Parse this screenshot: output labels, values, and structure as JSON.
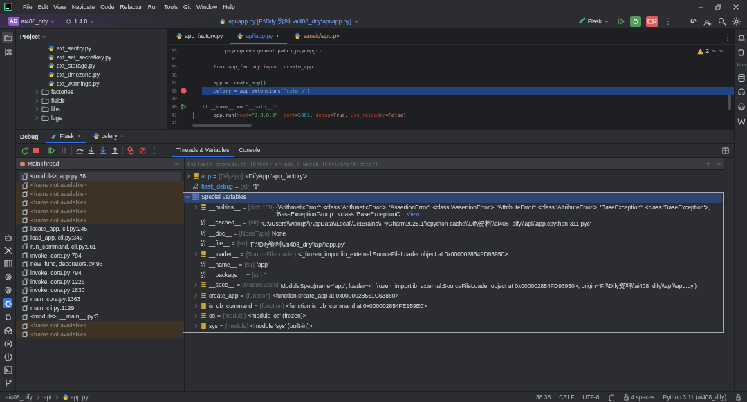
{
  "menu": [
    "File",
    "Edit",
    "View",
    "Navigate",
    "Code",
    "Refactor",
    "Run",
    "Tools",
    "Git",
    "Window",
    "Help"
  ],
  "toolbar": {
    "project_badge": "AD",
    "project": "ai408_dify",
    "version": "1.4.0",
    "file_title": "api\\app.py [F:\\Dify资料\\ai408_dify\\api\\app.py]",
    "run_config": "Flask",
    "stop_count": "2"
  },
  "project_panel": {
    "title": "Project",
    "items": [
      {
        "kind": "file",
        "name": "ext_sentry.py"
      },
      {
        "kind": "file",
        "name": "ext_set_secretkey.py"
      },
      {
        "kind": "file",
        "name": "ext_storage.py"
      },
      {
        "kind": "file",
        "name": "ext_timezone.py"
      },
      {
        "kind": "file",
        "name": "ext_warnings.py"
      },
      {
        "kind": "folder",
        "name": "factories",
        "expanded": false
      },
      {
        "kind": "folder",
        "name": "fields",
        "expanded": false
      },
      {
        "kind": "folder",
        "name": "libs",
        "expanded": false
      },
      {
        "kind": "folder",
        "name": "logs",
        "expanded": false
      }
    ]
  },
  "editor": {
    "tabs": [
      {
        "kind": "project",
        "label": "app_factory.py",
        "selected": false,
        "closable": false
      },
      {
        "kind": "project",
        "label": "api\\app.py",
        "selected": true,
        "closable": true
      },
      {
        "kind": "library",
        "label": "sansio\\app.py",
        "selected": false,
        "closable": false
      }
    ],
    "warnings": "2",
    "lines": [
      {
        "number": "33",
        "breakpoint": false,
        "run": false,
        "current": false,
        "modified": false,
        "tokens": [
          {
            "kind": "plain",
            "text": "        psycogreen.gevent.patch_psycopg()"
          }
        ]
      },
      {
        "number": "34",
        "breakpoint": false,
        "run": false,
        "current": false,
        "modified": false
      },
      {
        "number": "35",
        "breakpoint": false,
        "run": false,
        "current": false,
        "modified": false,
        "tokens": [
          {
            "kind": "keyword",
            "text": "    from"
          },
          {
            "kind": "plain",
            "text": " app_factory "
          },
          {
            "kind": "keyword",
            "text": "import"
          },
          {
            "kind": "plain",
            "text": " create_app"
          }
        ]
      },
      {
        "number": "36",
        "breakpoint": false,
        "run": false,
        "current": false,
        "modified": false
      },
      {
        "number": "37",
        "breakpoint": false,
        "run": false,
        "current": false,
        "modified": false,
        "tokens": [
          {
            "kind": "plain",
            "text": "    app = create_app()"
          }
        ]
      },
      {
        "number": "38",
        "breakpoint": true,
        "run": false,
        "current": true,
        "modified": false,
        "tokens": [
          {
            "kind": "plain",
            "text": "    celery = app.extensions["
          },
          {
            "kind": "string",
            "text": "\"celery\""
          },
          {
            "kind": "plain",
            "text": "]"
          }
        ]
      },
      {
        "number": "39",
        "breakpoint": false,
        "run": false,
        "current": false,
        "modified": false
      },
      {
        "number": "40",
        "breakpoint": false,
        "run": true,
        "current": false,
        "modified": false,
        "tokens": [
          {
            "kind": "keyword",
            "text": "if"
          },
          {
            "kind": "plain",
            "text": " __name__ == "
          },
          {
            "kind": "string",
            "text": "\"__main__\""
          },
          {
            "kind": "plain",
            "text": ":"
          }
        ]
      },
      {
        "number": "41",
        "breakpoint": false,
        "run": false,
        "current": false,
        "modified": true,
        "tokens": [
          {
            "kind": "plain",
            "text": "    app.run("
          },
          {
            "kind": "param",
            "text": "host"
          },
          {
            "kind": "plain",
            "text": "="
          },
          {
            "kind": "string",
            "text": "\"0.0.0.0\""
          },
          {
            "kind": "plain",
            "text": ", "
          },
          {
            "kind": "param",
            "text": "port"
          },
          {
            "kind": "plain",
            "text": "="
          },
          {
            "kind": "number",
            "text": "5001"
          },
          {
            "kind": "plain",
            "text": ", "
          },
          {
            "kind": "param",
            "text": "debug"
          },
          {
            "kind": "plain",
            "text": "="
          },
          {
            "kind": "keyword",
            "text": "True"
          },
          {
            "kind": "plain",
            "text": ", "
          },
          {
            "kind": "param",
            "text": "use_reloader"
          },
          {
            "kind": "plain",
            "text": "="
          },
          {
            "kind": "keyword",
            "text": "False"
          },
          {
            "kind": "plain",
            "text": ")"
          }
        ]
      },
      {
        "number": "42",
        "breakpoint": false,
        "run": false,
        "current": false,
        "modified": false
      }
    ]
  },
  "debug": {
    "title": "Debug",
    "sessions": [
      {
        "label": "Flask",
        "selected": true
      },
      {
        "label": "celery",
        "selected": false
      }
    ],
    "tabs": [
      {
        "label": "Threads & Variables",
        "selected": true
      },
      {
        "label": "Console",
        "selected": false
      }
    ],
    "thread": "MainThread",
    "frames": [
      {
        "label": "<module>, app.py:38",
        "available": true,
        "selected": true
      },
      {
        "label": "<frame not available>",
        "available": false,
        "selected": false
      },
      {
        "label": "<frame not available>",
        "available": false,
        "selected": false
      },
      {
        "label": "<frame not available>",
        "available": false,
        "selected": false
      },
      {
        "label": "<frame not available>",
        "available": false,
        "selected": false
      },
      {
        "label": "<frame not available>",
        "available": false,
        "selected": false
      },
      {
        "label": "locate_app, cli.py:245",
        "available": true,
        "selected": false
      },
      {
        "label": "load_app, cli.py:349",
        "available": true,
        "selected": false
      },
      {
        "label": "run_command, cli.py:961",
        "available": true,
        "selected": false
      },
      {
        "label": "invoke, core.py:794",
        "available": true,
        "selected": false
      },
      {
        "label": "new_func, decorators.py:93",
        "available": true,
        "selected": false
      },
      {
        "label": "invoke, core.py:794",
        "available": true,
        "selected": false
      },
      {
        "label": "invoke, core.py:1226",
        "available": true,
        "selected": false
      },
      {
        "label": "invoke, core.py:1830",
        "available": true,
        "selected": false
      },
      {
        "label": "main, core.py:1363",
        "available": true,
        "selected": false
      },
      {
        "label": "main, cli.py:1129",
        "available": true,
        "selected": false
      },
      {
        "label": "<module>, __main__.py:3",
        "available": true,
        "selected": false
      },
      {
        "label": "<frame not available>",
        "available": false,
        "selected": false
      },
      {
        "label": "<frame not available>",
        "available": false,
        "selected": false
      }
    ],
    "evaluate_placeholder": "Evaluate expression (Enter) or add a watch (Ctrl+Shift+Enter)",
    "variables": [
      {
        "kind": "object",
        "name": "app",
        "op": "=",
        "type": "{DifyApp}",
        "value": "<DifyApp 'app_factory'>",
        "expanded": false,
        "selected": false
      },
      {
        "kind": "primitive",
        "name": "flask_debug",
        "op": "=",
        "type": "{str}",
        "value": "'1'",
        "selected": false
      },
      {
        "kind": "group",
        "name": "Special Variables",
        "expanded": true,
        "selected": true,
        "children": [
          {
            "kind": "object",
            "name": "__builtins__",
            "op": "=",
            "type": "{dict: 158}",
            "value": "{'ArithmeticError': <class 'ArithmeticError'>, 'AssertionError': <class 'AssertionError'>, 'AttributeError': <class 'AttributeError'>, 'BaseException': <class 'BaseException'>, 'BaseExceptionGroup': <class 'BaseExceptionC...",
            "link": "View",
            "expanded": false,
            "selected": false
          },
          {
            "kind": "primitive",
            "name": "__cached__",
            "op": "=",
            "type": "{str}",
            "value": "'C:\\\\Users\\\\wangs\\\\AppData\\\\Local\\\\JetBrains\\\\PyCharm2025.1\\\\cpython-cache\\\\Dify资料\\\\ai408_dify\\\\api\\\\app.cpython-311.pyc'",
            "selected": false
          },
          {
            "kind": "primitive",
            "name": "__doc__",
            "op": "=",
            "type": "{NoneType}",
            "value": "None",
            "selected": false
          },
          {
            "kind": "primitive",
            "name": "__file__",
            "op": "=",
            "type": "{str}",
            "value": "'F:\\\\Dify资料\\\\ai408_dify\\\\api\\\\app.py'",
            "selected": false
          },
          {
            "kind": "object",
            "name": "__loader__",
            "op": "=",
            "type": "{SourceFileLoader}",
            "value": "<_frozen_importlib_external.SourceFileLoader object at 0x000002854FD93950>",
            "expanded": false,
            "selected": false
          },
          {
            "kind": "primitive",
            "name": "__name__",
            "op": "=",
            "type": "{str}",
            "value": "'app'",
            "selected": false
          },
          {
            "kind": "primitive",
            "name": "__package__",
            "op": "=",
            "type": "{str}",
            "value": "''",
            "selected": false
          },
          {
            "kind": "object",
            "name": "__spec__",
            "op": "=",
            "type": "{ModuleSpec}",
            "value": "ModuleSpec(name='app', loader=<_frozen_importlib_external.SourceFileLoader object at 0x000002854FD93950>, origin='F:\\\\Dify资料\\\\ai408_dify\\\\api\\\\app.py')",
            "expanded": false,
            "selected": false
          },
          {
            "kind": "object",
            "name": "create_app",
            "op": "=",
            "type": "{function}",
            "value": "<function create_app at 0x0000028551C63880>",
            "expanded": false,
            "selected": false
          },
          {
            "kind": "object",
            "name": "is_db_command",
            "op": "=",
            "type": "{function}",
            "value": "<function is_db_command at 0x000002854FE159E0>",
            "expanded": false,
            "selected": false
          },
          {
            "kind": "object",
            "name": "os",
            "op": "=",
            "type": "{module}",
            "value": "<module 'os' (frozen)>",
            "expanded": false,
            "selected": false
          },
          {
            "kind": "object",
            "name": "sys",
            "op": "=",
            "type": "{module}",
            "value": "<module 'sys' (built-in)>",
            "expanded": false,
            "selected": false
          }
        ]
      }
    ]
  },
  "right_strip": {
    "json_label": "Json"
  },
  "status_bar": {
    "breadcrumbs": [
      "ai408_dify",
      "api",
      "app.py"
    ],
    "position": "38:38",
    "line_separator": "CRLF",
    "encoding": "UTF-8",
    "indent": "4 spaces",
    "interpreter": "Python 3.11 (ai408_dify)"
  }
}
